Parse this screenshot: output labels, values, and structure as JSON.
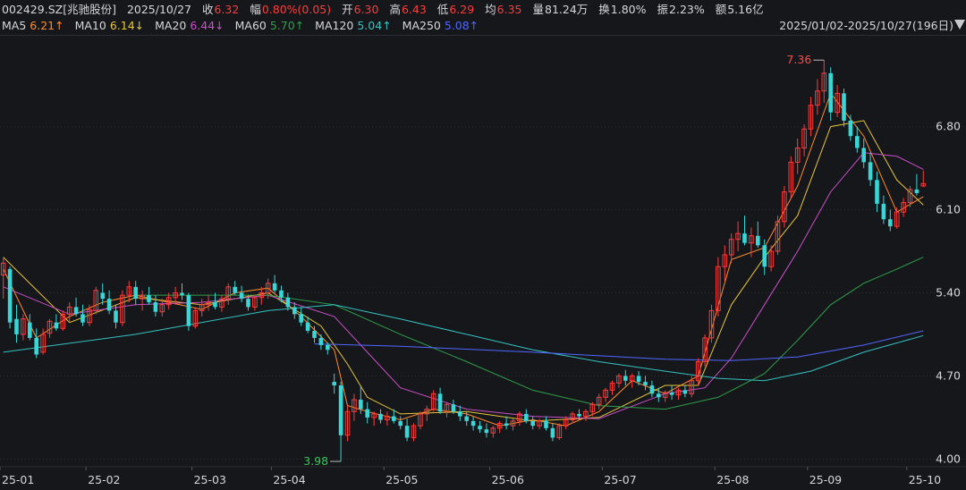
{
  "quote": {
    "symbol": "002429.SZ[兆驰股份]",
    "date": "2025/10/27",
    "close_label": "收",
    "close": "6.32",
    "change_label": "幅",
    "change": "0.80%(0.05)",
    "open_label": "开",
    "open": "6.30",
    "high_label": "高",
    "high": "6.43",
    "low_label": "低",
    "low": "6.29",
    "avg_label": "均",
    "avg": "6.35",
    "volume_label": "量",
    "volume": "81.24万",
    "turnover_label": "换",
    "turnover": "1.80%",
    "amplitude_label": "振",
    "amplitude": "2.23%",
    "amount_label": "额",
    "amount": "5.16亿"
  },
  "ma_legend": [
    {
      "label": "MA5",
      "value": "6.21↑",
      "color": "#ff8c2e"
    },
    {
      "label": "MA10",
      "value": "6.14↓",
      "color": "#e6c53a"
    },
    {
      "label": "MA20",
      "value": "6.44↓",
      "color": "#c94fc7"
    },
    {
      "label": "MA60",
      "value": "5.70↑",
      "color": "#2e9f4a"
    },
    {
      "label": "MA120",
      "value": "5.04↑",
      "color": "#34c2c2"
    },
    {
      "label": "MA250",
      "value": "5.08↑",
      "color": "#5067ff"
    }
  ],
  "range_label": "2025/01/02-2025/10/27(196日)",
  "colors": {
    "up": "#ff3b3b",
    "down": "#38d6d6",
    "background": "#16171b",
    "grid": "#2c2e35",
    "text": "#d6d7dc",
    "max_label": "#ff4a4a",
    "min_label": "#33c75a"
  },
  "icons": {
    "range_dropdown": "caret-down-icon"
  },
  "chart_data": {
    "type": "candlestick",
    "y_ticks": [
      "6.80",
      "6.10",
      "5.40",
      "4.70",
      "4.00"
    ],
    "x_ticks": [
      "25-01",
      "25-02",
      "25-03",
      "25-04",
      "25-05",
      "25-06",
      "25-07",
      "25-08",
      "25-09",
      "25-10"
    ],
    "max_label": "7.36",
    "min_label": "3.98",
    "max_marker_value": 7.36,
    "min_marker_value": 3.98,
    "ylim": [
      3.95,
      7.55
    ],
    "candles": [
      [
        5.55,
        5.7,
        5.35,
        5.65
      ],
      [
        5.6,
        5.62,
        5.1,
        5.15
      ],
      [
        5.18,
        5.3,
        4.98,
        5.05
      ],
      [
        5.05,
        5.22,
        5.0,
        5.18
      ],
      [
        5.15,
        5.22,
        5.0,
        5.02
      ],
      [
        5.02,
        5.1,
        4.85,
        4.88
      ],
      [
        4.9,
        5.1,
        4.88,
        5.05
      ],
      [
        5.06,
        5.18,
        5.02,
        5.16
      ],
      [
        5.15,
        5.22,
        5.08,
        5.1
      ],
      [
        5.1,
        5.25,
        5.08,
        5.22
      ],
      [
        5.22,
        5.32,
        5.15,
        5.28
      ],
      [
        5.28,
        5.36,
        5.2,
        5.22
      ],
      [
        5.22,
        5.3,
        5.12,
        5.15
      ],
      [
        5.15,
        5.3,
        5.12,
        5.26
      ],
      [
        5.25,
        5.45,
        5.22,
        5.42
      ],
      [
        5.4,
        5.48,
        5.3,
        5.35
      ],
      [
        5.35,
        5.42,
        5.22,
        5.25
      ],
      [
        5.25,
        5.3,
        5.1,
        5.15
      ],
      [
        5.15,
        5.42,
        5.12,
        5.38
      ],
      [
        5.38,
        5.5,
        5.32,
        5.45
      ],
      [
        5.45,
        5.5,
        5.3,
        5.35
      ],
      [
        5.35,
        5.42,
        5.25,
        5.38
      ],
      [
        5.38,
        5.45,
        5.3,
        5.32
      ],
      [
        5.32,
        5.38,
        5.2,
        5.24
      ],
      [
        5.24,
        5.35,
        5.2,
        5.3
      ],
      [
        5.3,
        5.4,
        5.26,
        5.36
      ],
      [
        5.36,
        5.45,
        5.3,
        5.4
      ],
      [
        5.4,
        5.48,
        5.34,
        5.38
      ],
      [
        5.38,
        5.4,
        5.08,
        5.12
      ],
      [
        5.12,
        5.28,
        5.1,
        5.25
      ],
      [
        5.25,
        5.35,
        5.2,
        5.3
      ],
      [
        5.3,
        5.38,
        5.25,
        5.32
      ],
      [
        5.32,
        5.4,
        5.26,
        5.28
      ],
      [
        5.28,
        5.38,
        5.24,
        5.35
      ],
      [
        5.35,
        5.48,
        5.3,
        5.45
      ],
      [
        5.45,
        5.5,
        5.38,
        5.4
      ],
      [
        5.4,
        5.46,
        5.32,
        5.35
      ],
      [
        5.35,
        5.38,
        5.25,
        5.28
      ],
      [
        5.28,
        5.38,
        5.25,
        5.36
      ],
      [
        5.36,
        5.45,
        5.3,
        5.4
      ],
      [
        5.4,
        5.52,
        5.35,
        5.48
      ],
      [
        5.48,
        5.55,
        5.4,
        5.42
      ],
      [
        5.42,
        5.46,
        5.32,
        5.36
      ],
      [
        5.36,
        5.4,
        5.25,
        5.28
      ],
      [
        5.28,
        5.32,
        5.18,
        5.22
      ],
      [
        5.22,
        5.28,
        5.12,
        5.15
      ],
      [
        5.15,
        5.2,
        5.06,
        5.08
      ],
      [
        5.08,
        5.12,
        4.98,
        5.02
      ],
      [
        5.02,
        5.05,
        4.92,
        4.96
      ],
      [
        4.96,
        4.98,
        4.88,
        4.92
      ],
      [
        4.65,
        4.72,
        4.55,
        4.62
      ],
      [
        4.62,
        4.65,
        3.98,
        4.2
      ],
      [
        4.2,
        4.45,
        4.15,
        4.4
      ],
      [
        4.4,
        4.55,
        4.32,
        4.5
      ],
      [
        4.5,
        4.62,
        4.38,
        4.42
      ],
      [
        4.42,
        4.48,
        4.3,
        4.35
      ],
      [
        4.35,
        4.4,
        4.28,
        4.38
      ],
      [
        4.38,
        4.42,
        4.3,
        4.33
      ],
      [
        4.33,
        4.4,
        4.28,
        4.36
      ],
      [
        4.36,
        4.42,
        4.3,
        4.32
      ],
      [
        4.32,
        4.36,
        4.25,
        4.28
      ],
      [
        4.28,
        4.34,
        4.15,
        4.18
      ],
      [
        4.18,
        4.3,
        4.15,
        4.28
      ],
      [
        4.28,
        4.4,
        4.25,
        4.38
      ],
      [
        4.38,
        4.45,
        4.32,
        4.42
      ],
      [
        4.42,
        4.58,
        4.4,
        4.55
      ],
      [
        4.55,
        4.6,
        4.38,
        4.4
      ],
      [
        4.4,
        4.48,
        4.35,
        4.46
      ],
      [
        4.46,
        4.5,
        4.38,
        4.4
      ],
      [
        4.4,
        4.45,
        4.32,
        4.36
      ],
      [
        4.36,
        4.4,
        4.28,
        4.32
      ],
      [
        4.32,
        4.36,
        4.24,
        4.28
      ],
      [
        4.28,
        4.32,
        4.22,
        4.25
      ],
      [
        4.25,
        4.3,
        4.18,
        4.22
      ],
      [
        4.22,
        4.28,
        4.18,
        4.26
      ],
      [
        4.26,
        4.32,
        4.22,
        4.3
      ],
      [
        4.3,
        4.36,
        4.25,
        4.28
      ],
      [
        4.28,
        4.34,
        4.24,
        4.32
      ],
      [
        4.32,
        4.4,
        4.28,
        4.38
      ],
      [
        4.38,
        4.42,
        4.3,
        4.32
      ],
      [
        4.32,
        4.36,
        4.25,
        4.28
      ],
      [
        4.28,
        4.34,
        4.25,
        4.32
      ],
      [
        4.32,
        4.36,
        4.24,
        4.26
      ],
      [
        4.26,
        4.3,
        4.15,
        4.18
      ],
      [
        4.18,
        4.3,
        4.16,
        4.28
      ],
      [
        4.28,
        4.36,
        4.25,
        4.33
      ],
      [
        4.33,
        4.4,
        4.3,
        4.38
      ],
      [
        4.38,
        4.42,
        4.33,
        4.36
      ],
      [
        4.36,
        4.42,
        4.32,
        4.4
      ],
      [
        4.4,
        4.48,
        4.36,
        4.46
      ],
      [
        4.46,
        4.55,
        4.42,
        4.52
      ],
      [
        4.52,
        4.6,
        4.48,
        4.58
      ],
      [
        4.58,
        4.66,
        4.54,
        4.64
      ],
      [
        4.64,
        4.72,
        4.6,
        4.7
      ],
      [
        4.7,
        4.75,
        4.62,
        4.66
      ],
      [
        4.66,
        4.72,
        4.6,
        4.7
      ],
      [
        4.7,
        4.74,
        4.62,
        4.65
      ],
      [
        4.65,
        4.7,
        4.58,
        4.62
      ],
      [
        4.62,
        4.66,
        4.52,
        4.55
      ],
      [
        4.55,
        4.6,
        4.48,
        4.52
      ],
      [
        4.52,
        4.58,
        4.48,
        4.56
      ],
      [
        4.56,
        4.62,
        4.5,
        4.54
      ],
      [
        4.54,
        4.6,
        4.5,
        4.58
      ],
      [
        4.58,
        4.62,
        4.52,
        4.55
      ],
      [
        4.55,
        4.7,
        4.52,
        4.66
      ],
      [
        4.66,
        4.85,
        4.62,
        4.82
      ],
      [
        4.82,
        5.05,
        4.78,
        5.02
      ],
      [
        5.02,
        5.3,
        4.98,
        5.25
      ],
      [
        5.25,
        5.7,
        5.2,
        5.62
      ],
      [
        5.62,
        5.8,
        5.5,
        5.72
      ],
      [
        5.72,
        5.9,
        5.65,
        5.85
      ],
      [
        5.85,
        6.0,
        5.75,
        5.9
      ],
      [
        5.9,
        6.05,
        5.8,
        5.82
      ],
      [
        5.82,
        5.95,
        5.7,
        5.88
      ],
      [
        5.88,
        6.0,
        5.78,
        5.8
      ],
      [
        5.8,
        5.85,
        5.55,
        5.62
      ],
      [
        5.62,
        5.8,
        5.58,
        5.75
      ],
      [
        5.75,
        6.05,
        5.72,
        6.0
      ],
      [
        6.0,
        6.3,
        5.95,
        6.25
      ],
      [
        6.25,
        6.55,
        6.2,
        6.5
      ],
      [
        6.5,
        6.7,
        6.4,
        6.62
      ],
      [
        6.62,
        6.82,
        6.55,
        6.78
      ],
      [
        6.78,
        7.05,
        6.72,
        6.98
      ],
      [
        6.98,
        7.2,
        6.9,
        7.1
      ],
      [
        7.1,
        7.36,
        7.0,
        7.25
      ],
      [
        7.25,
        7.3,
        6.85,
        6.92
      ],
      [
        6.92,
        7.15,
        6.88,
        7.08
      ],
      [
        7.08,
        7.12,
        6.8,
        6.85
      ],
      [
        6.85,
        6.9,
        6.68,
        6.72
      ],
      [
        6.72,
        6.8,
        6.58,
        6.62
      ],
      [
        6.62,
        6.7,
        6.45,
        6.5
      ],
      [
        6.5,
        6.58,
        6.3,
        6.35
      ],
      [
        6.35,
        6.42,
        6.08,
        6.15
      ],
      [
        6.15,
        6.22,
        5.98,
        6.02
      ],
      [
        6.02,
        6.1,
        5.92,
        5.96
      ],
      [
        5.96,
        6.12,
        5.94,
        6.08
      ],
      [
        6.08,
        6.2,
        6.04,
        6.16
      ],
      [
        6.16,
        6.3,
        6.12,
        6.27
      ],
      [
        6.27,
        6.4,
        6.22,
        6.24
      ],
      [
        6.3,
        6.43,
        6.29,
        6.32
      ]
    ],
    "ma_series": [
      {
        "name": "MA5",
        "values": [
          [
            0,
            5.6
          ],
          [
            5,
            5.02
          ],
          [
            10,
            5.2
          ],
          [
            15,
            5.32
          ],
          [
            20,
            5.38
          ],
          [
            25,
            5.32
          ],
          [
            30,
            5.26
          ],
          [
            35,
            5.4
          ],
          [
            40,
            5.44
          ],
          [
            45,
            5.2
          ],
          [
            50,
            4.92
          ],
          [
            52,
            4.45
          ],
          [
            55,
            4.4
          ],
          [
            60,
            4.33
          ],
          [
            65,
            4.42
          ],
          [
            70,
            4.38
          ],
          [
            75,
            4.28
          ],
          [
            80,
            4.33
          ],
          [
            85,
            4.28
          ],
          [
            90,
            4.4
          ],
          [
            95,
            4.66
          ],
          [
            100,
            4.55
          ],
          [
            105,
            4.7
          ],
          [
            110,
            5.68
          ],
          [
            115,
            5.78
          ],
          [
            120,
            6.3
          ],
          [
            125,
            7.08
          ],
          [
            130,
            6.72
          ],
          [
            135,
            6.08
          ],
          [
            139,
            6.21
          ]
        ]
      },
      {
        "name": "MA10",
        "values": [
          [
            0,
            5.7
          ],
          [
            10,
            5.15
          ],
          [
            20,
            5.36
          ],
          [
            30,
            5.3
          ],
          [
            40,
            5.4
          ],
          [
            48,
            5.12
          ],
          [
            52,
            4.8
          ],
          [
            55,
            4.52
          ],
          [
            60,
            4.38
          ],
          [
            70,
            4.4
          ],
          [
            80,
            4.32
          ],
          [
            90,
            4.35
          ],
          [
            100,
            4.62
          ],
          [
            105,
            4.62
          ],
          [
            110,
            5.3
          ],
          [
            115,
            5.7
          ],
          [
            120,
            6.05
          ],
          [
            125,
            6.8
          ],
          [
            130,
            6.85
          ],
          [
            135,
            6.35
          ],
          [
            139,
            6.14
          ]
        ]
      },
      {
        "name": "MA20",
        "values": [
          [
            0,
            5.45
          ],
          [
            10,
            5.22
          ],
          [
            20,
            5.3
          ],
          [
            30,
            5.32
          ],
          [
            40,
            5.38
          ],
          [
            50,
            5.2
          ],
          [
            55,
            4.9
          ],
          [
            60,
            4.6
          ],
          [
            70,
            4.42
          ],
          [
            80,
            4.36
          ],
          [
            90,
            4.34
          ],
          [
            100,
            4.55
          ],
          [
            106,
            4.6
          ],
          [
            110,
            4.85
          ],
          [
            115,
            5.3
          ],
          [
            120,
            5.75
          ],
          [
            125,
            6.25
          ],
          [
            130,
            6.58
          ],
          [
            135,
            6.55
          ],
          [
            139,
            6.44
          ]
        ]
      },
      {
        "name": "MA60",
        "values": [
          [
            20,
            5.38
          ],
          [
            40,
            5.38
          ],
          [
            50,
            5.3
          ],
          [
            60,
            5.05
          ],
          [
            70,
            4.82
          ],
          [
            80,
            4.58
          ],
          [
            90,
            4.45
          ],
          [
            100,
            4.42
          ],
          [
            108,
            4.52
          ],
          [
            115,
            4.72
          ],
          [
            120,
            5.0
          ],
          [
            125,
            5.3
          ],
          [
            130,
            5.48
          ],
          [
            135,
            5.6
          ],
          [
            139,
            5.7
          ]
        ]
      },
      {
        "name": "MA120",
        "values": [
          [
            0,
            4.9
          ],
          [
            20,
            5.05
          ],
          [
            40,
            5.25
          ],
          [
            50,
            5.3
          ],
          [
            60,
            5.18
          ],
          [
            70,
            5.05
          ],
          [
            80,
            4.92
          ],
          [
            90,
            4.82
          ],
          [
            100,
            4.74
          ],
          [
            108,
            4.68
          ],
          [
            115,
            4.66
          ],
          [
            122,
            4.74
          ],
          [
            130,
            4.9
          ],
          [
            139,
            5.04
          ]
        ]
      },
      {
        "name": "MA250",
        "values": [
          [
            47,
            4.97
          ],
          [
            60,
            4.95
          ],
          [
            80,
            4.9
          ],
          [
            100,
            4.84
          ],
          [
            110,
            4.83
          ],
          [
            120,
            4.86
          ],
          [
            130,
            4.96
          ],
          [
            139,
            5.08
          ]
        ]
      }
    ]
  }
}
